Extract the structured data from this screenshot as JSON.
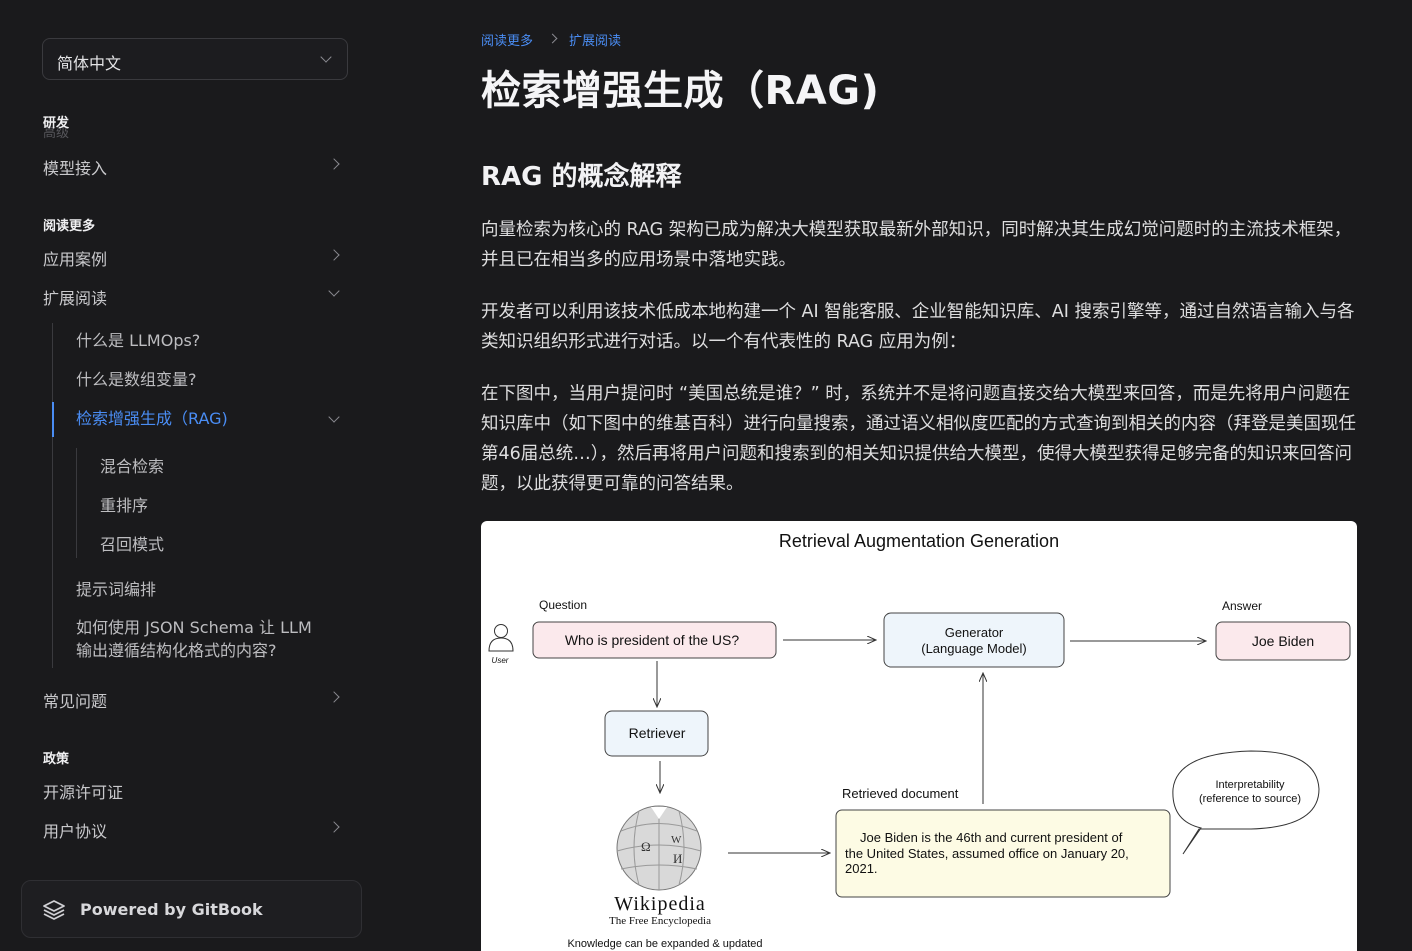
{
  "sidebar": {
    "language_select": "简体中文",
    "faded_item": "高级",
    "section_dev": "研发",
    "model_access": "模型接入",
    "section_read_more": "阅读更多",
    "use_cases": "应用案例",
    "extended_reading": "扩展阅读",
    "sub_items": [
      "什么是 LLMOps?",
      "什么是数组变量?",
      "检索增强生成（RAG)"
    ],
    "rag_children": [
      "混合检索",
      "重排序",
      "召回模式"
    ],
    "prompt_orchestration": "提示词编排",
    "json_schema": "如何使用 JSON Schema 让 LLM 输出遵循结构化格式的内容?",
    "faq": "常见问题",
    "section_policy": "政策",
    "open_source_license": "开源许可证",
    "user_agreement": "用户协议",
    "powered_by": "Powered by GitBook"
  },
  "breadcrumb": [
    "阅读更多",
    "扩展阅读"
  ],
  "page_title": "检索增强生成（RAG)",
  "section_heading": "RAG 的概念解释",
  "paragraphs": [
    "向量检索为核心的 RAG 架构已成为解决大模型获取最新外部知识，同时解决其生成幻觉问题时的主流技术框架，并且已在相当多的应用场景中落地实践。",
    "开发者可以利用该技术低成本地构建一个 AI 智能客服、企业智能知识库、AI 搜索引擎等，通过自然语言输入与各类知识组织形式进行对话。以一个有代表性的 RAG 应用为例：",
    "在下图中，当用户提问时 “美国总统是谁？” 时，系统并不是将问题直接交给大模型来回答，而是先将用户问题在知识库中（如下图中的维基百科）进行向量搜索，通过语义相似度匹配的方式查询到相关的内容（拜登是美国现任第46届总统…），然后再将用户问题和搜索到的相关知识提供给大模型，使得大模型获得足够完备的知识来回答问题，以此获得更可靠的问答结果。"
  ],
  "diagram": {
    "title": "Retrieval Augmentation Generation",
    "question_label": "Question",
    "question": "Who is president of the US?",
    "user_label": "User",
    "generator_line1": "Generator",
    "generator_line2": "(Language Model)",
    "answer_label": "Answer",
    "answer": "Joe Biden",
    "retriever": "Retriever",
    "retrieved_label": "Retrieved document",
    "retrieved_line1": "Joe Biden is the 46th and current president of",
    "retrieved_line2": "the United States, assumed office on January 20,",
    "retrieved_line3": "2021.",
    "interp_line1": "Interpretability",
    "interp_line2": "(reference to source)",
    "wiki_name": "Wikipedia",
    "wiki_tagline": "The Free Encyclopedia",
    "wiki_note": "Knowledge can be expanded & updated"
  }
}
